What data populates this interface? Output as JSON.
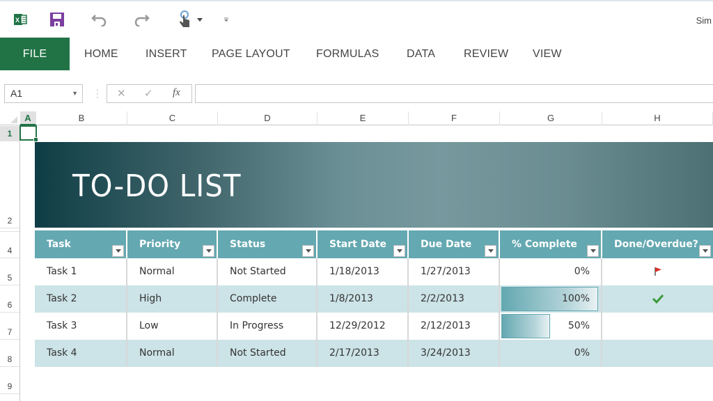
{
  "qat": {
    "icons": [
      "excel-logo-icon",
      "save-icon",
      "undo-icon",
      "redo-icon",
      "touch-mode-icon",
      "customize-qat-icon"
    ],
    "user": "Sim"
  },
  "ribbon": {
    "tabs": [
      "FILE",
      "HOME",
      "INSERT",
      "PAGE LAYOUT",
      "FORMULAS",
      "DATA",
      "REVIEW",
      "VIEW"
    ]
  },
  "formula_bar": {
    "name_box": "A1",
    "cancel": "✕",
    "enter": "✓",
    "fx": "fx",
    "formula": ""
  },
  "grid": {
    "columns": [
      "A",
      "B",
      "C",
      "D",
      "E",
      "F",
      "G",
      "H"
    ],
    "rows": [
      "1",
      "2",
      "4",
      "5",
      "6",
      "7",
      "8",
      "9"
    ],
    "selected_cell": "A1"
  },
  "banner": {
    "title": "TO-DO LIST"
  },
  "table": {
    "headers": [
      "Task",
      "Priority",
      "Status",
      "Start Date",
      "Due Date",
      "% Complete",
      "Done/Overdue?"
    ],
    "rows": [
      {
        "task": "Task 1",
        "priority": "Normal",
        "status": "Not Started",
        "start": "1/18/2013",
        "due": "1/27/2013",
        "pct": "0%",
        "pct_value": 0,
        "flag": "overdue-flag"
      },
      {
        "task": "Task 2",
        "priority": "High",
        "status": "Complete",
        "start": "1/8/2013",
        "due": "2/2/2013",
        "pct": "100%",
        "pct_value": 100,
        "flag": "done-check"
      },
      {
        "task": "Task 3",
        "priority": "Low",
        "status": "In Progress",
        "start": "12/29/2012",
        "due": "2/12/2013",
        "pct": "50%",
        "pct_value": 50,
        "flag": ""
      },
      {
        "task": "Task 4",
        "priority": "Normal",
        "status": "Not Started",
        "start": "2/17/2013",
        "due": "3/24/2013",
        "pct": "0%",
        "pct_value": 0,
        "flag": ""
      }
    ]
  },
  "colors": {
    "excel_green": "#217346",
    "header_teal": "#64a8b1",
    "band_row": "#cce3e7",
    "banner_dark": "#0f3d45",
    "flag_red": "#d9302c",
    "check_green": "#3b9a3b"
  }
}
